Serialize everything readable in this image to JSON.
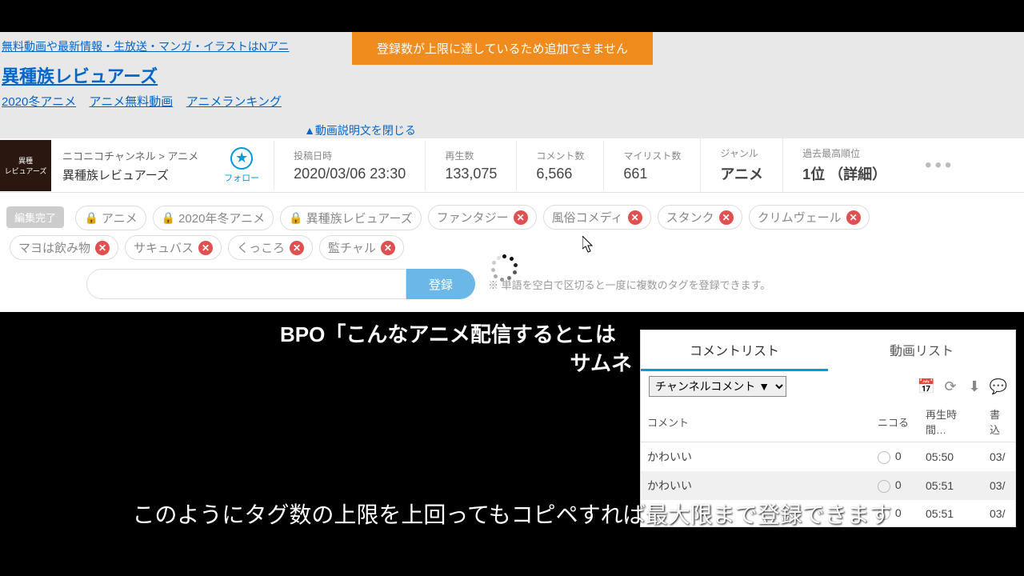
{
  "toast": "登録数が上限に達しているため追加できません",
  "nav_top": "無料動画や最新情報・生放送・マンガ・イラストはNアニ",
  "title": "異種族レビュアーズ",
  "categories": [
    "2020冬アニメ",
    "アニメ無料動画",
    "アニメランキング"
  ],
  "close_desc": "▲動画説明文を閉じる",
  "breadcrumb": {
    "path": "ニコニコチャンネル > アニメ",
    "series": "異種族レビュアーズ"
  },
  "follow_label": "フォロー",
  "stats": [
    {
      "label": "投稿日時",
      "value": "2020/03/06 23:30"
    },
    {
      "label": "再生数",
      "value": "133,075"
    },
    {
      "label": "コメント数",
      "value": "6,566"
    },
    {
      "label": "マイリスト数",
      "value": "661"
    },
    {
      "label": "ジャンル",
      "value": "アニメ"
    },
    {
      "label": "過去最高順位",
      "value": "1位 （詳細）"
    }
  ],
  "edit_done": "編集完了",
  "tags_locked": [
    "アニメ",
    "2020年冬アニメ",
    "異種族レビュアーズ"
  ],
  "tags_removable": [
    "ファンタジー",
    "風俗コメディ",
    "スタンク",
    "クリムヴェール",
    "マヨは飲み物",
    "サキュバス",
    "くっころ",
    "監チャル"
  ],
  "register_btn": "登録",
  "tag_hint": "※ 単語を空白で区切ると一度に複数のタグを登録できます。",
  "video_overlay1": "BPO「こんなアニメ配信するとこは",
  "video_overlay2": "サムネ",
  "side": {
    "tab1": "コメントリスト",
    "tab2": "動画リスト",
    "select": "チャンネルコメント ▼",
    "headers": [
      "コメント",
      "ニコる",
      "再生時間…",
      "書込"
    ],
    "rows": [
      {
        "text": "かわいい",
        "niko": "0",
        "time": "05:50",
        "date": "03/"
      },
      {
        "text": "かわいい",
        "niko": "0",
        "time": "05:51",
        "date": "03/"
      },
      {
        "text": "",
        "niko": "0",
        "time": "05:51",
        "date": "03/"
      }
    ]
  },
  "subtitle": "このようにタグ数の上限を上回ってもコピペすれば最大限まで登録できます"
}
